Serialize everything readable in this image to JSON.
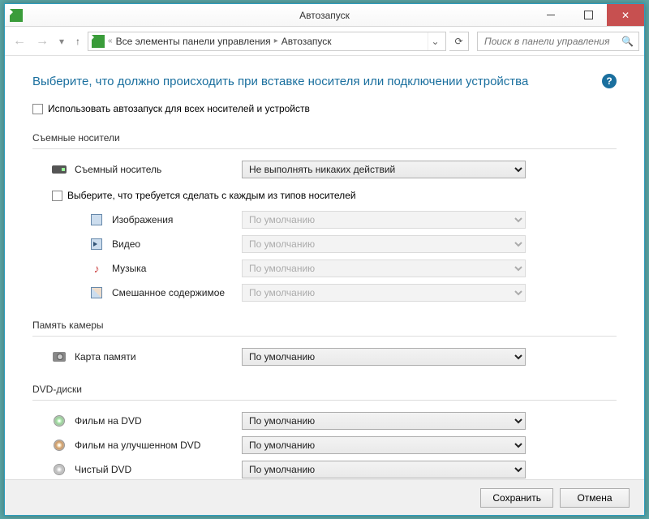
{
  "window": {
    "title": "Автозапуск"
  },
  "nav": {
    "breadcrumb_prefix": "«",
    "crumb1": "Все элементы панели управления",
    "crumb2": "Автозапуск",
    "search_placeholder": "Поиск в панели управления"
  },
  "page": {
    "heading": "Выберите, что должно происходить при вставке носителя или подключении устройства",
    "master_checkbox": "Использовать автозапуск для всех носителей и устройств"
  },
  "sections": {
    "removable": {
      "title": "Съемные носители",
      "drive_label": "Съемный носитель",
      "drive_value": "Не выполнять никаких действий",
      "per_type_checkbox": "Выберите, что требуется сделать с каждым из типов носителей",
      "images_label": "Изображения",
      "images_value": "По умолчанию",
      "video_label": "Видео",
      "video_value": "По умолчанию",
      "music_label": "Музыка",
      "music_value": "По умолчанию",
      "mixed_label": "Смешанное содержимое",
      "mixed_value": "По умолчанию"
    },
    "camera": {
      "title": "Память камеры",
      "card_label": "Карта памяти",
      "card_value": "По умолчанию"
    },
    "dvd": {
      "title": "DVD-диски",
      "movie_label": "Фильм на DVD",
      "movie_value": "По умолчанию",
      "enhanced_label": "Фильм на улучшенном DVD",
      "enhanced_value": "По умолчанию",
      "blank_label": "Чистый DVD",
      "blank_value": "По умолчанию"
    }
  },
  "footer": {
    "save": "Сохранить",
    "cancel": "Отмена"
  }
}
